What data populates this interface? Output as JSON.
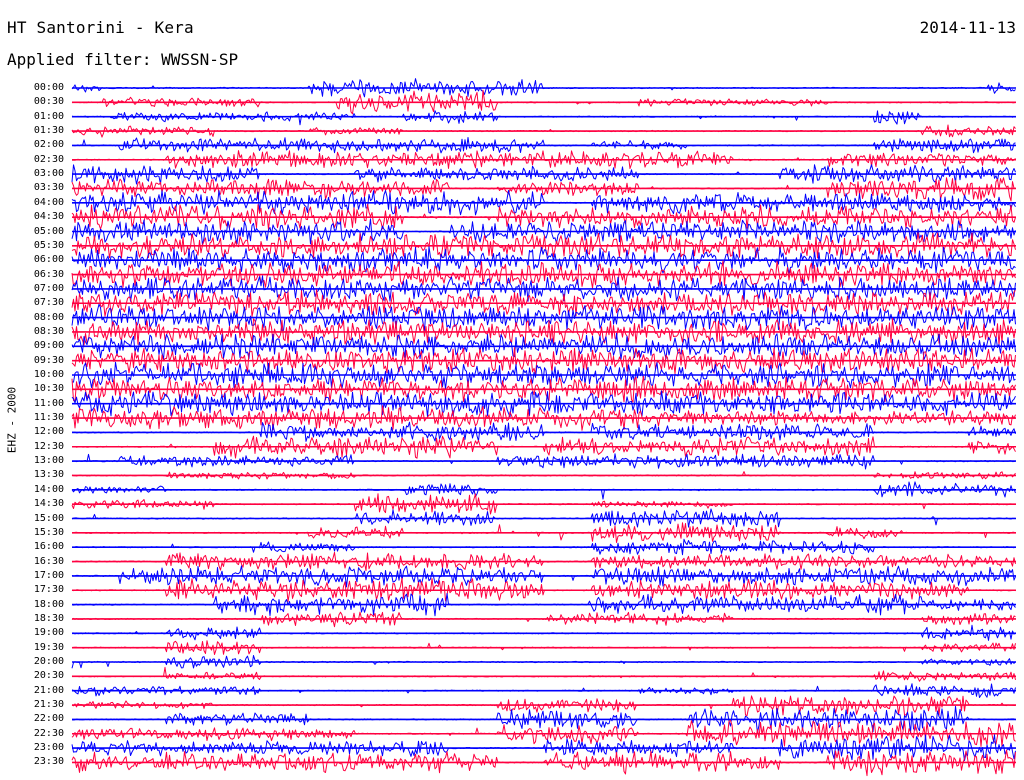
{
  "header": {
    "station_title": "HT Santorini - Kera",
    "date": "2014-11-13",
    "filter_text": "Applied filter: WWSSN-SP"
  },
  "channel_label": "EHZ - 2000",
  "chart_data": {
    "type": "line",
    "title": "HT Santorini - Kera",
    "subtitle": "Applied filter: WWSSN-SP",
    "ylabel": "EHZ - 2000",
    "date": "2014-11-13",
    "row_labels": [
      "00:00",
      "00:30",
      "01:00",
      "01:30",
      "02:00",
      "02:30",
      "03:00",
      "03:30",
      "04:00",
      "04:30",
      "05:00",
      "05:30",
      "06:00",
      "06:30",
      "07:00",
      "07:30",
      "08:00",
      "08:30",
      "09:00",
      "09:30",
      "10:00",
      "10:30",
      "11:00",
      "11:30",
      "12:00",
      "12:30",
      "13:00",
      "13:30",
      "14:00",
      "14:30",
      "15:00",
      "15:30",
      "16:00",
      "16:30",
      "17:00",
      "17:30",
      "18:00",
      "18:30",
      "19:00",
      "19:30",
      "20:00",
      "20:30",
      "21:00",
      "21:30",
      "22:00",
      "22:30",
      "23:00",
      "23:30"
    ],
    "colors": [
      "#0000ff",
      "#ff0040"
    ],
    "row_minutes": 30,
    "activity_segments": [
      [
        [
          0.0,
          0.03,
          0.3
        ],
        [
          0.25,
          0.5,
          0.7
        ],
        [
          0.97,
          1,
          0.4
        ]
      ],
      [
        [
          0.03,
          0.2,
          0.4
        ],
        [
          0.28,
          0.45,
          0.9
        ],
        [
          0.6,
          0.8,
          0.3
        ]
      ],
      [
        [
          0.04,
          0.3,
          0.4
        ],
        [
          0.35,
          0.45,
          0.5
        ],
        [
          0.85,
          0.9,
          0.6
        ]
      ],
      [
        [
          0.0,
          0.15,
          0.4
        ],
        [
          0.25,
          0.35,
          0.3
        ],
        [
          0.9,
          1,
          0.5
        ]
      ],
      [
        [
          0.05,
          0.5,
          0.6
        ],
        [
          0.55,
          0.65,
          0.4
        ],
        [
          0.85,
          1,
          0.7
        ]
      ],
      [
        [
          0.1,
          0.7,
          0.7
        ],
        [
          0.8,
          1,
          0.6
        ]
      ],
      [
        [
          0.0,
          0.2,
          0.8
        ],
        [
          0.3,
          0.6,
          0.6
        ],
        [
          0.75,
          1,
          0.8
        ]
      ],
      [
        [
          0.0,
          0.4,
          0.8
        ],
        [
          0.45,
          0.6,
          0.6
        ],
        [
          0.8,
          1,
          0.9
        ]
      ],
      [
        [
          0.0,
          0.5,
          1.0
        ],
        [
          0.55,
          1,
          0.8
        ]
      ],
      [
        [
          0.0,
          0.35,
          1.0
        ],
        [
          0.45,
          1,
          0.9
        ]
      ],
      [
        [
          0.0,
          0.35,
          1.0
        ],
        [
          0.4,
          1,
          0.9
        ]
      ],
      [
        [
          0.0,
          1,
          1.0
        ]
      ],
      [
        [
          0.0,
          1,
          1.0
        ]
      ],
      [
        [
          0.0,
          1,
          1.0
        ]
      ],
      [
        [
          0.0,
          1,
          1.0
        ]
      ],
      [
        [
          0.0,
          1,
          1.0
        ]
      ],
      [
        [
          0.0,
          1,
          1.0
        ]
      ],
      [
        [
          0.0,
          1,
          1.0
        ]
      ],
      [
        [
          0.0,
          1,
          1.0
        ]
      ],
      [
        [
          0.0,
          1,
          1.0
        ]
      ],
      [
        [
          0.0,
          1,
          1.0
        ]
      ],
      [
        [
          0.0,
          1,
          1.0
        ]
      ],
      [
        [
          0.0,
          0.68,
          1.0
        ],
        [
          0.68,
          1,
          0.9
        ]
      ],
      [
        [
          0.0,
          0.6,
          0.9
        ],
        [
          0.6,
          1,
          0.6
        ]
      ],
      [
        [
          0.2,
          0.5,
          0.8
        ],
        [
          0.55,
          0.85,
          0.7
        ],
        [
          0.95,
          1,
          0.6
        ]
      ],
      [
        [
          0.15,
          0.45,
          0.9
        ],
        [
          0.5,
          0.85,
          0.8
        ],
        [
          0.95,
          1,
          0.6
        ]
      ],
      [
        [
          0.05,
          0.3,
          0.5
        ],
        [
          0.45,
          0.85,
          0.6
        ]
      ],
      [
        [
          0.1,
          0.3,
          0.3
        ],
        [
          0.85,
          1,
          0.3
        ]
      ],
      [
        [
          0.0,
          0.1,
          0.3
        ],
        [
          0.35,
          0.45,
          0.6
        ],
        [
          0.85,
          1,
          0.6
        ]
      ],
      [
        [
          0.0,
          0.15,
          0.4
        ],
        [
          0.3,
          0.45,
          0.8
        ],
        [
          0.55,
          0.7,
          0.3
        ]
      ],
      [
        [
          0.3,
          0.45,
          0.6
        ],
        [
          0.55,
          0.75,
          0.8
        ]
      ],
      [
        [
          0.25,
          0.35,
          0.5
        ],
        [
          0.55,
          0.75,
          0.8
        ],
        [
          0.8,
          0.88,
          0.5
        ]
      ],
      [
        [
          0.2,
          0.3,
          0.4
        ],
        [
          0.55,
          0.85,
          0.6
        ]
      ],
      [
        [
          0.1,
          0.5,
          0.7
        ],
        [
          0.55,
          1,
          0.6
        ]
      ],
      [
        [
          0.05,
          0.5,
          0.8
        ],
        [
          0.55,
          1,
          0.8
        ]
      ],
      [
        [
          0.1,
          0.5,
          0.9
        ],
        [
          0.55,
          0.95,
          0.8
        ]
      ],
      [
        [
          0.15,
          0.4,
          0.9
        ],
        [
          0.55,
          0.9,
          0.8
        ],
        [
          0.9,
          1,
          0.5
        ]
      ],
      [
        [
          0.2,
          0.35,
          0.6
        ],
        [
          0.5,
          0.7,
          0.5
        ],
        [
          0.9,
          1,
          0.5
        ]
      ],
      [
        [
          0.1,
          0.2,
          0.5
        ],
        [
          0.9,
          1,
          0.6
        ]
      ],
      [
        [
          0.1,
          0.2,
          0.6
        ],
        [
          0.9,
          1,
          0.4
        ]
      ],
      [
        [
          0.1,
          0.2,
          0.5
        ],
        [
          0.9,
          1,
          0.3
        ]
      ],
      [
        [
          0.1,
          0.2,
          0.3
        ],
        [
          0.85,
          1,
          0.4
        ]
      ],
      [
        [
          0.0,
          0.2,
          0.4
        ],
        [
          0.6,
          0.7,
          0.3
        ],
        [
          0.85,
          1,
          0.6
        ]
      ],
      [
        [
          0.0,
          0.15,
          0.3
        ],
        [
          0.45,
          0.6,
          0.6
        ],
        [
          0.7,
          0.95,
          0.8
        ]
      ],
      [
        [
          0.1,
          0.25,
          0.5
        ],
        [
          0.45,
          0.6,
          0.9
        ],
        [
          0.65,
          0.95,
          1.0
        ]
      ],
      [
        [
          0.0,
          0.3,
          0.5
        ],
        [
          0.45,
          0.6,
          0.8
        ],
        [
          0.65,
          1,
          1.0
        ]
      ],
      [
        [
          0.0,
          0.4,
          0.6
        ],
        [
          0.5,
          0.7,
          0.8
        ],
        [
          0.75,
          1,
          1.0
        ]
      ],
      [
        [
          0.0,
          0.45,
          0.8
        ],
        [
          0.5,
          0.75,
          0.9
        ],
        [
          0.8,
          1,
          1.0
        ]
      ]
    ]
  }
}
